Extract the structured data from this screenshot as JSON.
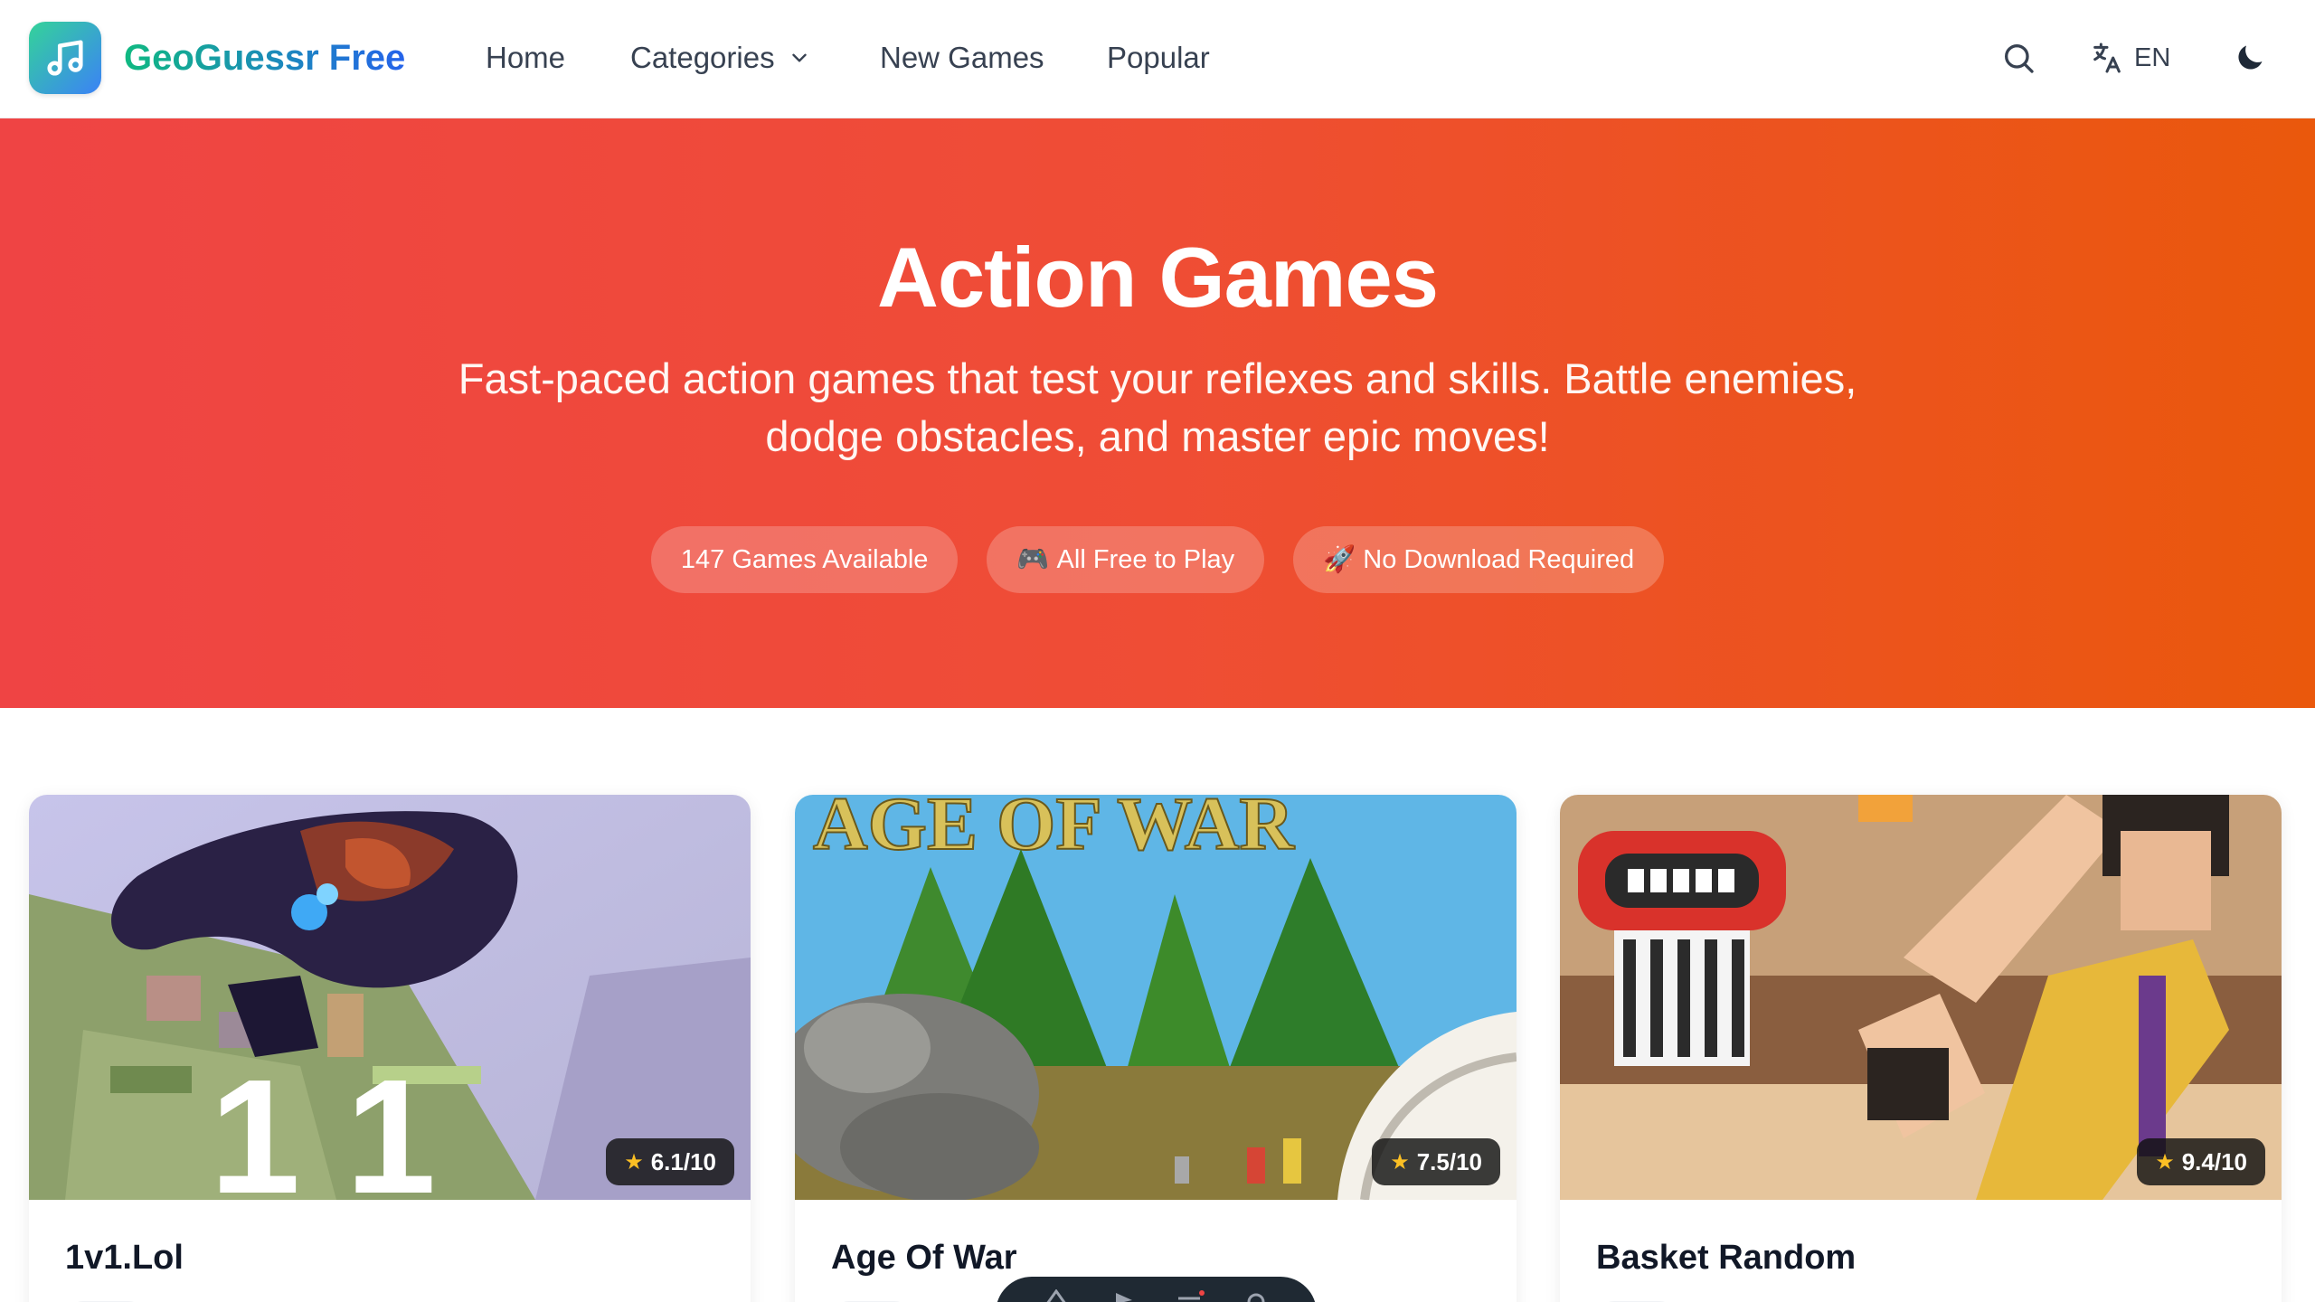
{
  "header": {
    "brand": "GeoGuessr Free",
    "nav": {
      "home": "Home",
      "categories": "Categories",
      "new_games": "New Games",
      "popular": "Popular"
    },
    "language": "EN",
    "icons": [
      "music-note-icon",
      "chevron-down-icon",
      "search-icon",
      "translate-icon",
      "moon-icon"
    ]
  },
  "hero": {
    "title": "Action Games",
    "description": "Fast-paced action games that test your reflexes and skills. Battle enemies, dodge obstacles, and master epic moves!",
    "badges": [
      {
        "emoji": "",
        "text": "147 Games Available"
      },
      {
        "emoji": "🎮",
        "text": "All Free to Play"
      },
      {
        "emoji": "🚀",
        "text": "No Download Required"
      }
    ]
  },
  "games": [
    {
      "title": "1v1.Lol",
      "rating": "6.1/10"
    },
    {
      "title": "Age Of War",
      "rating": "7.5/10",
      "thumb_text": "AGE OF WAR"
    },
    {
      "title": "Basket Random",
      "rating": "9.4/10"
    }
  ],
  "colors": {
    "hero_start": "#ef4444",
    "hero_end": "#ea580c",
    "brand_start": "#10b981",
    "brand_end": "#2563eb",
    "star": "#fbbf24"
  }
}
